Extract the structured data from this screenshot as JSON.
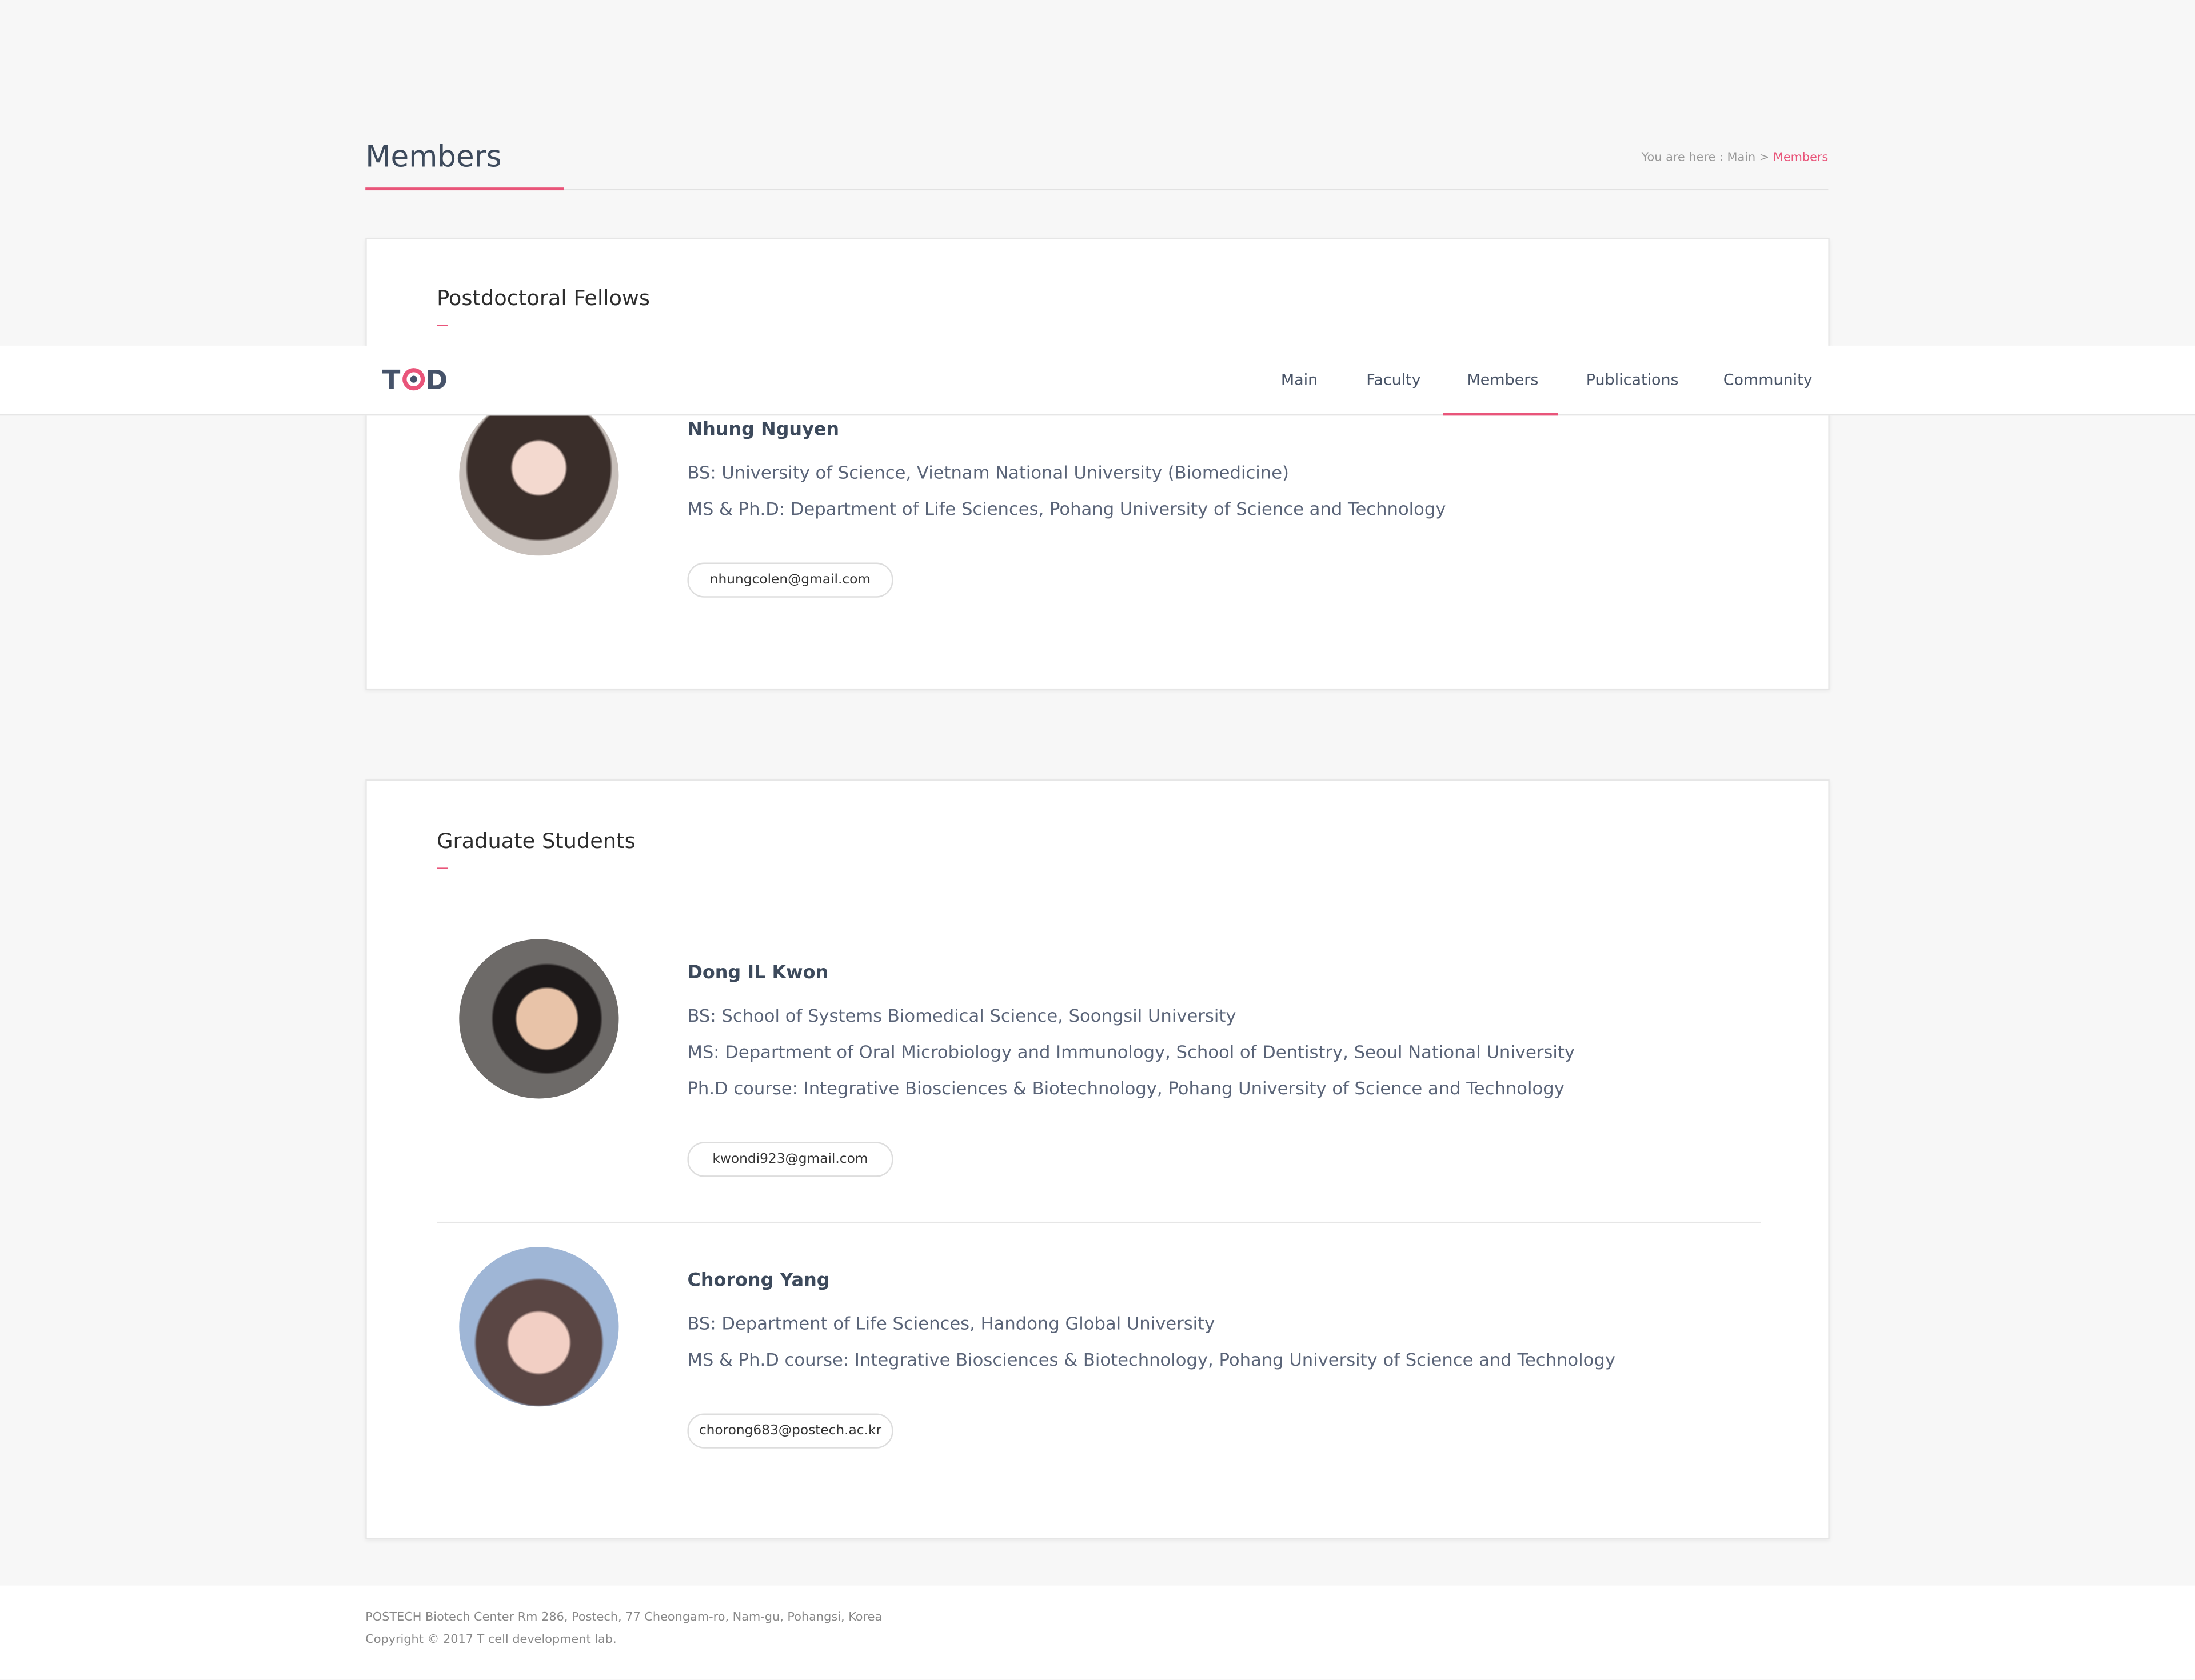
{
  "page": {
    "title": "Members"
  },
  "breadcrumb": {
    "prefix": "You are here : Main > ",
    "current": "Members"
  },
  "nav": {
    "logo": "TCD",
    "items": [
      {
        "label": "Main"
      },
      {
        "label": "Faculty"
      },
      {
        "label": "Members",
        "active": true
      },
      {
        "label": "Publications"
      },
      {
        "label": "Community"
      }
    ]
  },
  "sections": [
    {
      "heading": "Postdoctoral Fellows",
      "members": [
        {
          "name": "Nhung Nguyen",
          "lines": [
            "BS: University of Science, Vietnam National University (Biomedicine)",
            "MS & Ph.D: Department of Life Sciences, Pohang University of Science and Technology"
          ],
          "email": "nhungcolen@gmail.com"
        }
      ]
    },
    {
      "heading": "Graduate Students",
      "members": [
        {
          "name": "Dong IL Kwon",
          "lines": [
            "BS: School of Systems Biomedical Science, Soongsil University",
            "MS: Department of Oral Microbiology and Immunology, School of Dentistry, Seoul National University",
            "Ph.D course: Integrative Biosciences & Biotechnology, Pohang University of Science and Technology"
          ],
          "email": "kwondi923@gmail.com"
        },
        {
          "name": "Chorong Yang",
          "lines": [
            "BS: Department of Life Sciences, Handong Global University",
            "MS & Ph.D course: Integrative Biosciences & Biotechnology, Pohang University of Science and Technology"
          ],
          "email": "chorong683@postech.ac.kr"
        }
      ]
    }
  ],
  "footer": {
    "address": "POSTECH Biotech Center Rm 286, Postech, 77 Cheongam-ro, Nam-gu, Pohangsi, Korea",
    "copyright": "Copyright © 2017 T cell development lab."
  },
  "colors": {
    "accent": "#e9557a",
    "text": "#3d4a5c",
    "background": "#f7f7f7"
  }
}
